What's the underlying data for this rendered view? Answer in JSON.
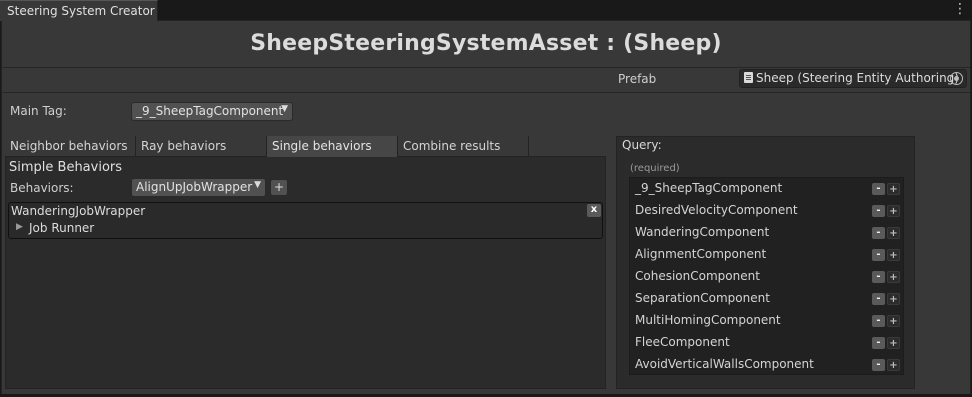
{
  "window": {
    "tab_title": "Steering System Creator",
    "menu_icon": "kebab-menu-icon"
  },
  "header": {
    "title": "SheepSteeringSystemAsset :  (Sheep)"
  },
  "prefab": {
    "label": "Prefab",
    "value": "Sheep (Steering Entity Authoring)",
    "icon": "prefab-document-icon",
    "picker_icon": "object-picker-icon"
  },
  "main_tag": {
    "label": "Main Tag:",
    "value": "_9_SheepTagComponent"
  },
  "tabs": [
    {
      "label": "Neighbor behaviors",
      "active": false
    },
    {
      "label": "Ray behaviors",
      "active": false
    },
    {
      "label": "Single behaviors",
      "active": true
    },
    {
      "label": "Combine results",
      "active": false
    }
  ],
  "single": {
    "section_title": "Simple Behaviors",
    "behaviors_label": "Behaviors:",
    "behaviors_value": "AlignUpJobWrapper",
    "add_label": "+",
    "items": [
      {
        "name": "WanderingJobWrapper",
        "remove_label": "x",
        "foldout_label": "Job Runner"
      }
    ]
  },
  "query": {
    "label": "Query:",
    "required_label": "(required)",
    "minus_label": "-",
    "plus_label": "+",
    "items": [
      "_9_SheepTagComponent",
      "DesiredVelocityComponent",
      "WanderingComponent",
      "AlignmentComponent",
      "CohesionComponent",
      "SeparationComponent",
      "MultiHomingComponent",
      "FleeComponent",
      "AvoidVerticalWallsComponent"
    ]
  },
  "colors": {
    "background": "#383838",
    "panel": "#2b2b2b",
    "list": "#212121",
    "dropdown": "#515151",
    "active_tab": "#464646"
  }
}
